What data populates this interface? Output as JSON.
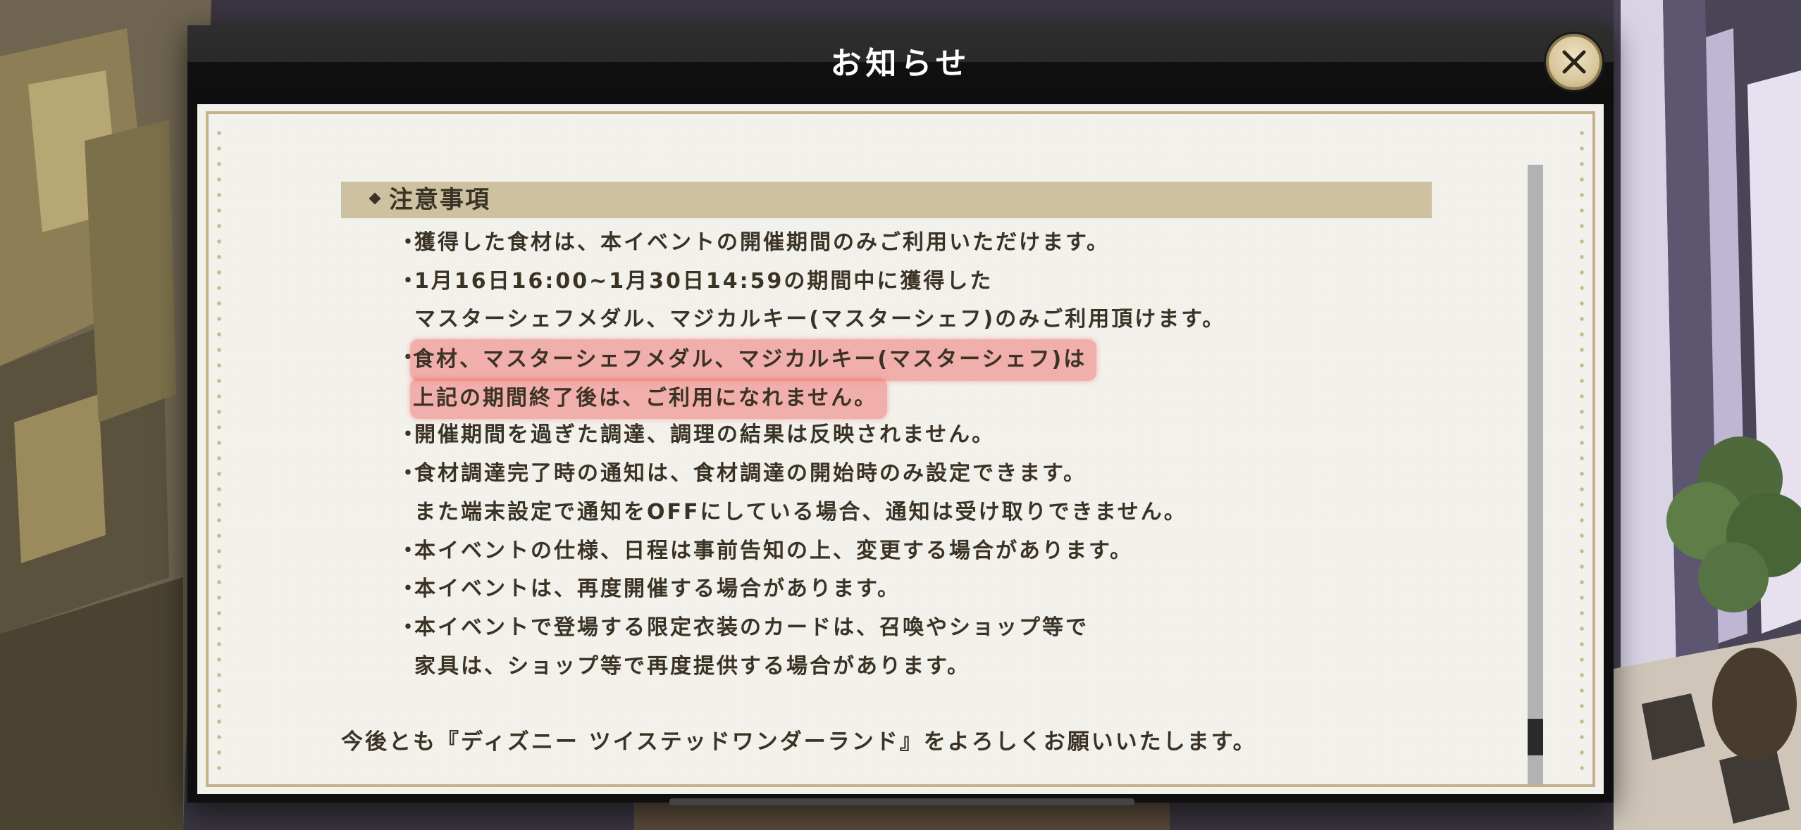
{
  "dialog": {
    "title": "お知らせ",
    "close_icon": "close-icon"
  },
  "section": {
    "title": "注意事項",
    "marker_icon": "diamond-icon"
  },
  "notes": [
    {
      "bullet": "・",
      "text": "獲得した食材は、本イベントの開催期間のみご利用いただけます。",
      "highlight": false
    },
    {
      "bullet": "・",
      "text": "1月16日16:00~1月30日14:59の期間中に獲得した",
      "highlight": false
    },
    {
      "bullet": "",
      "text": "マスターシェフメダル、マジカルキー(マスターシェフ)のみご利用頂けます。",
      "highlight": false
    },
    {
      "bullet": "・",
      "text": "食材、マスターシェフメダル、マジカルキー(マスターシェフ)は",
      "highlight": true
    },
    {
      "bullet": "",
      "text": "上記の期間終了後は、ご利用になれません。",
      "highlight": true
    },
    {
      "bullet": "・",
      "text": "開催期間を過ぎた調達、調理の結果は反映されません。",
      "highlight": false
    },
    {
      "bullet": "・",
      "text": "食材調達完了時の通知は、食材調達の開始時のみ設定できます。",
      "highlight": false
    },
    {
      "bullet": "",
      "text": "また端末設定で通知をOFFにしている場合、通知は受け取りできません。",
      "highlight": false
    },
    {
      "bullet": "・",
      "text": "本イベントの仕様、日程は事前告知の上、変更する場合があります。",
      "highlight": false
    },
    {
      "bullet": "・",
      "text": "本イベントは、再度開催する場合があります。",
      "highlight": false
    },
    {
      "bullet": "・",
      "text": "本イベントで登場する限定衣装のカードは、召喚やショップ等で",
      "highlight": false
    },
    {
      "bullet": "",
      "text": "家具は、ショップ等で再度提供する場合があります。",
      "highlight": false
    }
  ],
  "closing": "今後とも『ディズニー ツイステッドワンダーランド』をよろしくお願いいたします。",
  "scroll": {
    "position_fraction": 0.95
  },
  "colors": {
    "highlight": "#ee7876",
    "section_header_bg": "#cdc1a0",
    "text": "#3a3225",
    "paper": "#f3f1ec",
    "border_gold": "#c4b28a"
  }
}
